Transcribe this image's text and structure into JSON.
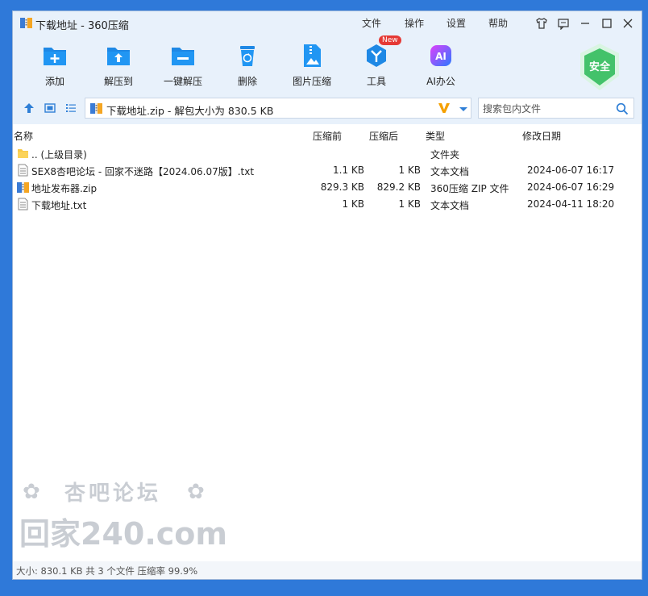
{
  "window": {
    "title": "下载地址 - 360压缩",
    "menus": [
      "文件",
      "操作",
      "设置",
      "帮助"
    ]
  },
  "toolbar": {
    "tools": [
      {
        "label": "添加",
        "icon": "add-icon"
      },
      {
        "label": "解压到",
        "icon": "extract-to-icon"
      },
      {
        "label": "一键解压",
        "icon": "one-click-extract-icon"
      },
      {
        "label": "删除",
        "icon": "delete-icon"
      },
      {
        "label": "图片压缩",
        "icon": "image-compress-icon"
      },
      {
        "label": "工具",
        "icon": "tools-icon"
      },
      {
        "label": "AI办公",
        "icon": "ai-office-icon"
      }
    ],
    "new_badge": "New",
    "ai_icon_text": "AI",
    "safe_label": "安全"
  },
  "address": {
    "path": "下载地址.zip - 解包大小为 830.5 KB"
  },
  "search": {
    "placeholder": "搜索包内文件"
  },
  "list": {
    "columns": [
      "名称",
      "压缩前",
      "压缩后",
      "类型",
      "修改日期"
    ],
    "rows": [
      {
        "name": ".. (上级目录)",
        "before": "",
        "after": "",
        "type": "文件夹",
        "date": "",
        "icon": "folder-icon"
      },
      {
        "name": "SEX8杏吧论坛 - 回家不迷路【2024.06.07版】.txt",
        "before": "1.1 KB",
        "after": "1 KB",
        "type": "文本文档",
        "date": "2024-06-07 16:17",
        "icon": "text-file-icon"
      },
      {
        "name": "地址发布器.zip",
        "before": "829.3 KB",
        "after": "829.2 KB",
        "type": "360压缩 ZIP 文件",
        "date": "2024-06-07 16:29",
        "icon": "zip-file-icon"
      },
      {
        "name": "下载地址.txt",
        "before": "1 KB",
        "after": "1 KB",
        "type": "文本文档",
        "date": "2024-04-11 18:20",
        "icon": "text-file-icon"
      }
    ]
  },
  "status": {
    "text": "大小: 830.1 KB 共 3 个文件 压缩率 99.9%"
  },
  "watermark": {
    "line1": "杏吧论坛",
    "line2": "回家240.com"
  },
  "colors": {
    "accent": "#1e88e5",
    "toolbar_bg": "#e8f1fb",
    "safe_green": "#43c26a"
  }
}
